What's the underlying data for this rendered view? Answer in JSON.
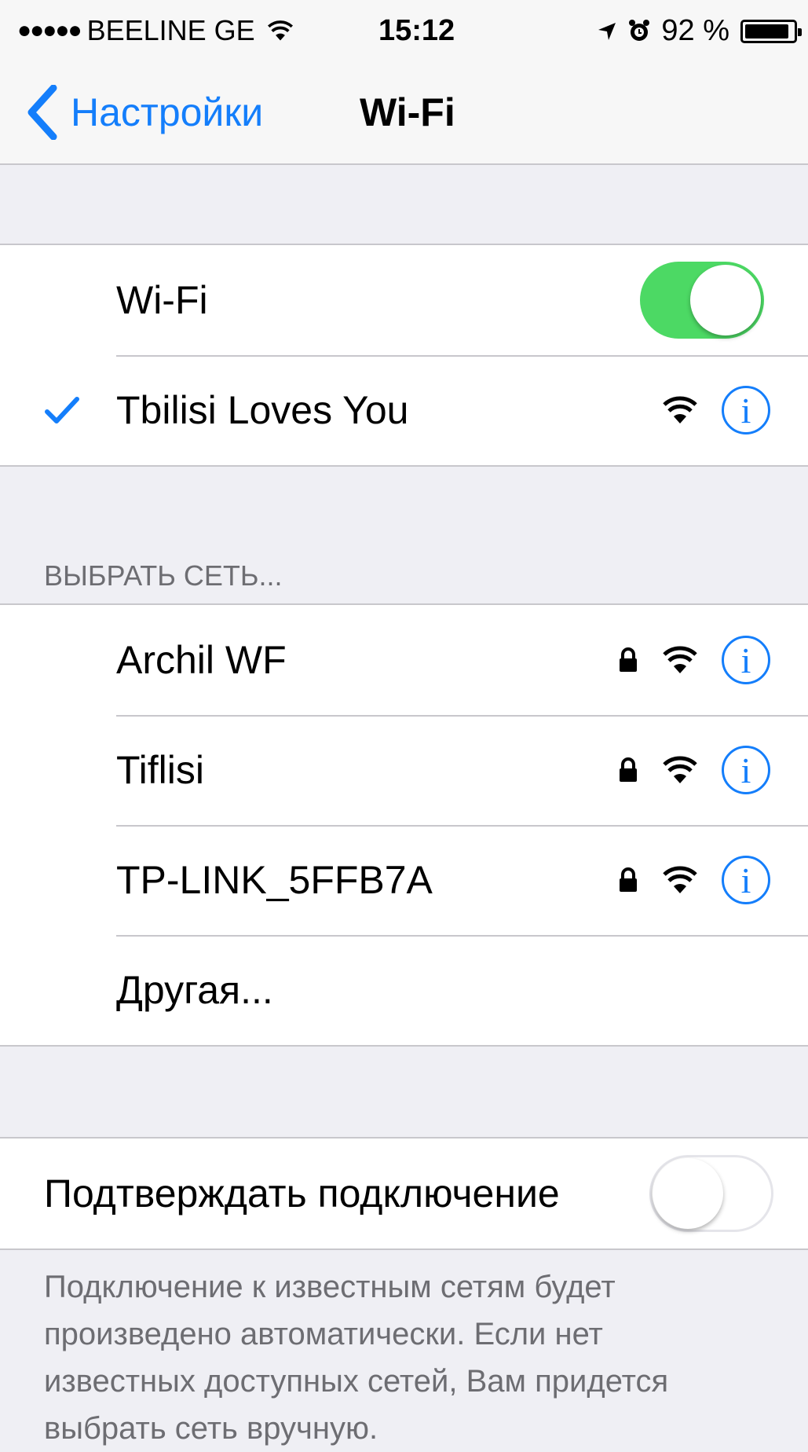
{
  "status_bar": {
    "signal_dots": "●●●●●",
    "carrier": "BEELINE GE",
    "time": "15:12",
    "battery_percent": "92 %",
    "battery_level": 0.92,
    "icons": [
      "signal-dots-icon",
      "wifi-icon",
      "location-arrow-icon",
      "alarm-icon",
      "battery-icon"
    ]
  },
  "nav": {
    "back_label": "Настройки",
    "title": "Wi-Fi"
  },
  "wifi_group": {
    "toggle_label": "Wi-Fi",
    "toggle_on": true,
    "connected_network": "Tbilisi Loves You"
  },
  "networks_section": {
    "header": "ВЫБРАТЬ СЕТЬ...",
    "networks": [
      {
        "name": "Archil WF",
        "secured": true
      },
      {
        "name": "Tiflisi",
        "secured": true
      },
      {
        "name": "TP-LINK_5FFB7A",
        "secured": true
      }
    ],
    "other_label": "Другая..."
  },
  "confirm_group": {
    "label": "Подтверждать подключение",
    "toggle_on": false
  },
  "footer": {
    "text": "Подключение к известным сетям будет произведено автоматически. Если нет известных доступных сетей, Вам придется выбрать сеть вручную."
  },
  "colors": {
    "accent": "#147efb",
    "toggle_on": "#4cd964",
    "background": "#efeff4",
    "separator": "#c8c7cc",
    "secondary_text": "#6d6d72"
  },
  "info_glyph": "i"
}
